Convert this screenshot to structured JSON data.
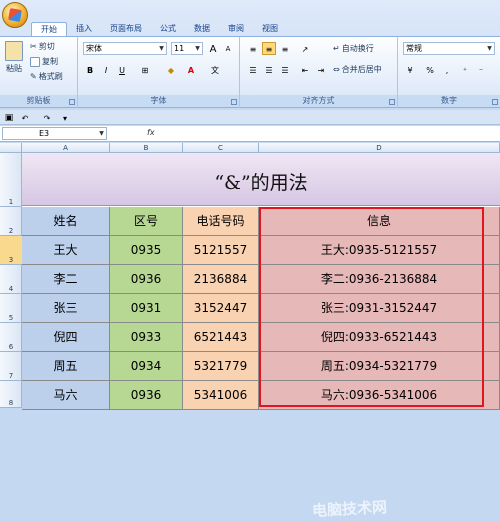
{
  "tabs": [
    "开始",
    "插入",
    "页面布局",
    "公式",
    "数据",
    "审阅",
    "视图"
  ],
  "clipboard": {
    "paste": "粘贴",
    "cut": "剪切",
    "copy": "复制",
    "format_painter": "格式刷",
    "label": "剪贴板"
  },
  "font": {
    "name": "宋体",
    "size": "11",
    "label": "字体",
    "bold": "B",
    "italic": "I",
    "underline": "U",
    "grow": "A",
    "shrink": "A"
  },
  "align": {
    "wrap": "自动换行",
    "merge": "合并后居中",
    "label": "对齐方式"
  },
  "number": {
    "format": "常规",
    "percent": "%",
    "comma": ",",
    "label": "数字"
  },
  "name_box": "E3",
  "fx": "fx",
  "columns": [
    "A",
    "B",
    "C",
    "D"
  ],
  "rows": [
    "1",
    "2",
    "3",
    "4",
    "5",
    "6",
    "7",
    "8"
  ],
  "sheet": {
    "title": "“&”的用法",
    "headers": [
      "姓名",
      "区号",
      "电话号码",
      "信息"
    ],
    "records": [
      [
        "王大",
        "0935",
        "5121557",
        "王大:0935-5121557"
      ],
      [
        "李二",
        "0936",
        "2136884",
        "李二:0936-2136884"
      ],
      [
        "张三",
        "0931",
        "3152447",
        "张三:0931-3152447"
      ],
      [
        "倪四",
        "0933",
        "6521443",
        "倪四:0933-6521443"
      ],
      [
        "周五",
        "0934",
        "5321779",
        "周五:0934-5321779"
      ],
      [
        "马六",
        "0936",
        "5341006",
        "马六:0936-5341006"
      ]
    ]
  },
  "highlight_color": "#e0151f",
  "watermark": "电脑技术网"
}
